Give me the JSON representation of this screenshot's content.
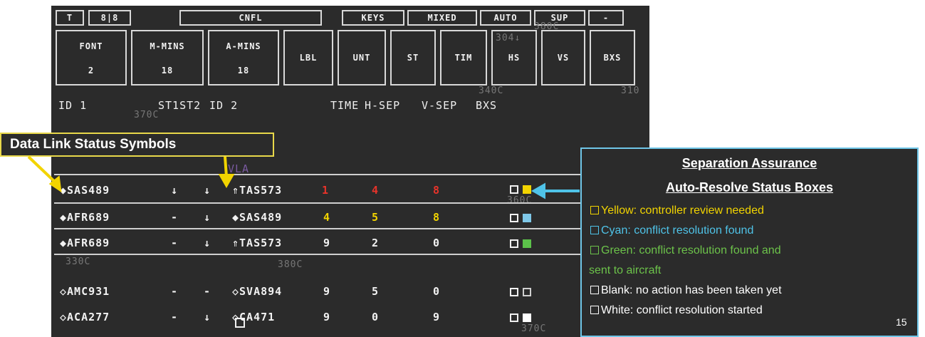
{
  "top_buttons": [
    "T",
    "8|8",
    "CNFL",
    "KEYS",
    "MIXED",
    "AUTO",
    "SUP",
    "-"
  ],
  "main_buttons": [
    {
      "l1": "FONT",
      "l2": "2"
    },
    {
      "l1": "M-MINS",
      "l2": "18"
    },
    {
      "l1": "A-MINS",
      "l2": "18"
    },
    {
      "l1": "LBL",
      "l2": ""
    },
    {
      "l1": "UNT",
      "l2": ""
    },
    {
      "l1": "ST",
      "l2": ""
    },
    {
      "l1": "TIM",
      "l2": ""
    },
    {
      "l1": "HS",
      "l2": ""
    },
    {
      "l1": "VS",
      "l2": ""
    },
    {
      "l1": "BXS",
      "l2": ""
    }
  ],
  "headers": {
    "id1": "ID 1",
    "st1st2": "ST1ST2",
    "id2": "ID 2",
    "time": "TIME",
    "hsep": "H-SEP",
    "vsep": "V-SEP",
    "bxs": "BXS"
  },
  "ghost_labels": [
    "380C",
    "304↓",
    "340C",
    "310",
    "370C",
    "VLA",
    "360C",
    "330C",
    "380C",
    "370C"
  ],
  "rows": [
    {
      "id1": "◆SAS489",
      "st1": "↓",
      "st2": "↓",
      "id2": "⇑TAS573",
      "time": "1",
      "hsep": "4",
      "vsep": "8",
      "color": "#e8332a",
      "box_fill": "#f2d400",
      "box_fill_outline": false
    },
    {
      "id1": "◆AFR689",
      "st1": "-",
      "st2": "↓",
      "id2": "◆SAS489",
      "time": "4",
      "hsep": "5",
      "vsep": "8",
      "color": "#f2d400",
      "box_fill": "#7fc8e8",
      "box_fill_outline": false
    },
    {
      "id1": "◆AFR689",
      "st1": "-",
      "st2": "↓",
      "id2": "⇑TAS573",
      "time": "9",
      "hsep": "2",
      "vsep": "0",
      "color": "#f2f2f2",
      "box_fill": "#5cc24a",
      "box_fill_outline": false
    },
    {
      "id1": "◇AMC931",
      "st1": "-",
      "st2": "-",
      "id2": "◇SVA894",
      "time": "9",
      "hsep": "5",
      "vsep": "0",
      "color": "#f2f2f2",
      "box_fill": "",
      "box_fill_outline": true
    },
    {
      "id1": "◇ACA277",
      "st1": "-",
      "st2": "↓",
      "id2": "◇CA471",
      "time": "9",
      "hsep": "0",
      "vsep": "9",
      "color": "#f2f2f2",
      "box_fill": "#ffffff",
      "box_fill_outline": false
    }
  ],
  "callout": {
    "text": "Data Link Status Symbols"
  },
  "legend": {
    "title1": "Separation Assurance",
    "title2": "Auto-Resolve Status Boxes",
    "items": [
      {
        "text": "Yellow: controller review needed",
        "color": "#f2d400"
      },
      {
        "text": "Cyan: conflict resolution found",
        "color": "#4fc3e8"
      },
      {
        "text": "Green:  conflict resolution found and",
        "color": "#6cc24a"
      },
      {
        "text": "sent to aircraft",
        "color": "#6cc24a"
      },
      {
        "text": "Blank: no action has been taken yet",
        "color": "#ffffff"
      },
      {
        "text": "White: conflict resolution started",
        "color": "#ffffff"
      }
    ]
  },
  "slide_number": "15",
  "colors": {
    "arrow_yellow": "#f2d400",
    "arrow_cyan": "#4fc3e8"
  }
}
